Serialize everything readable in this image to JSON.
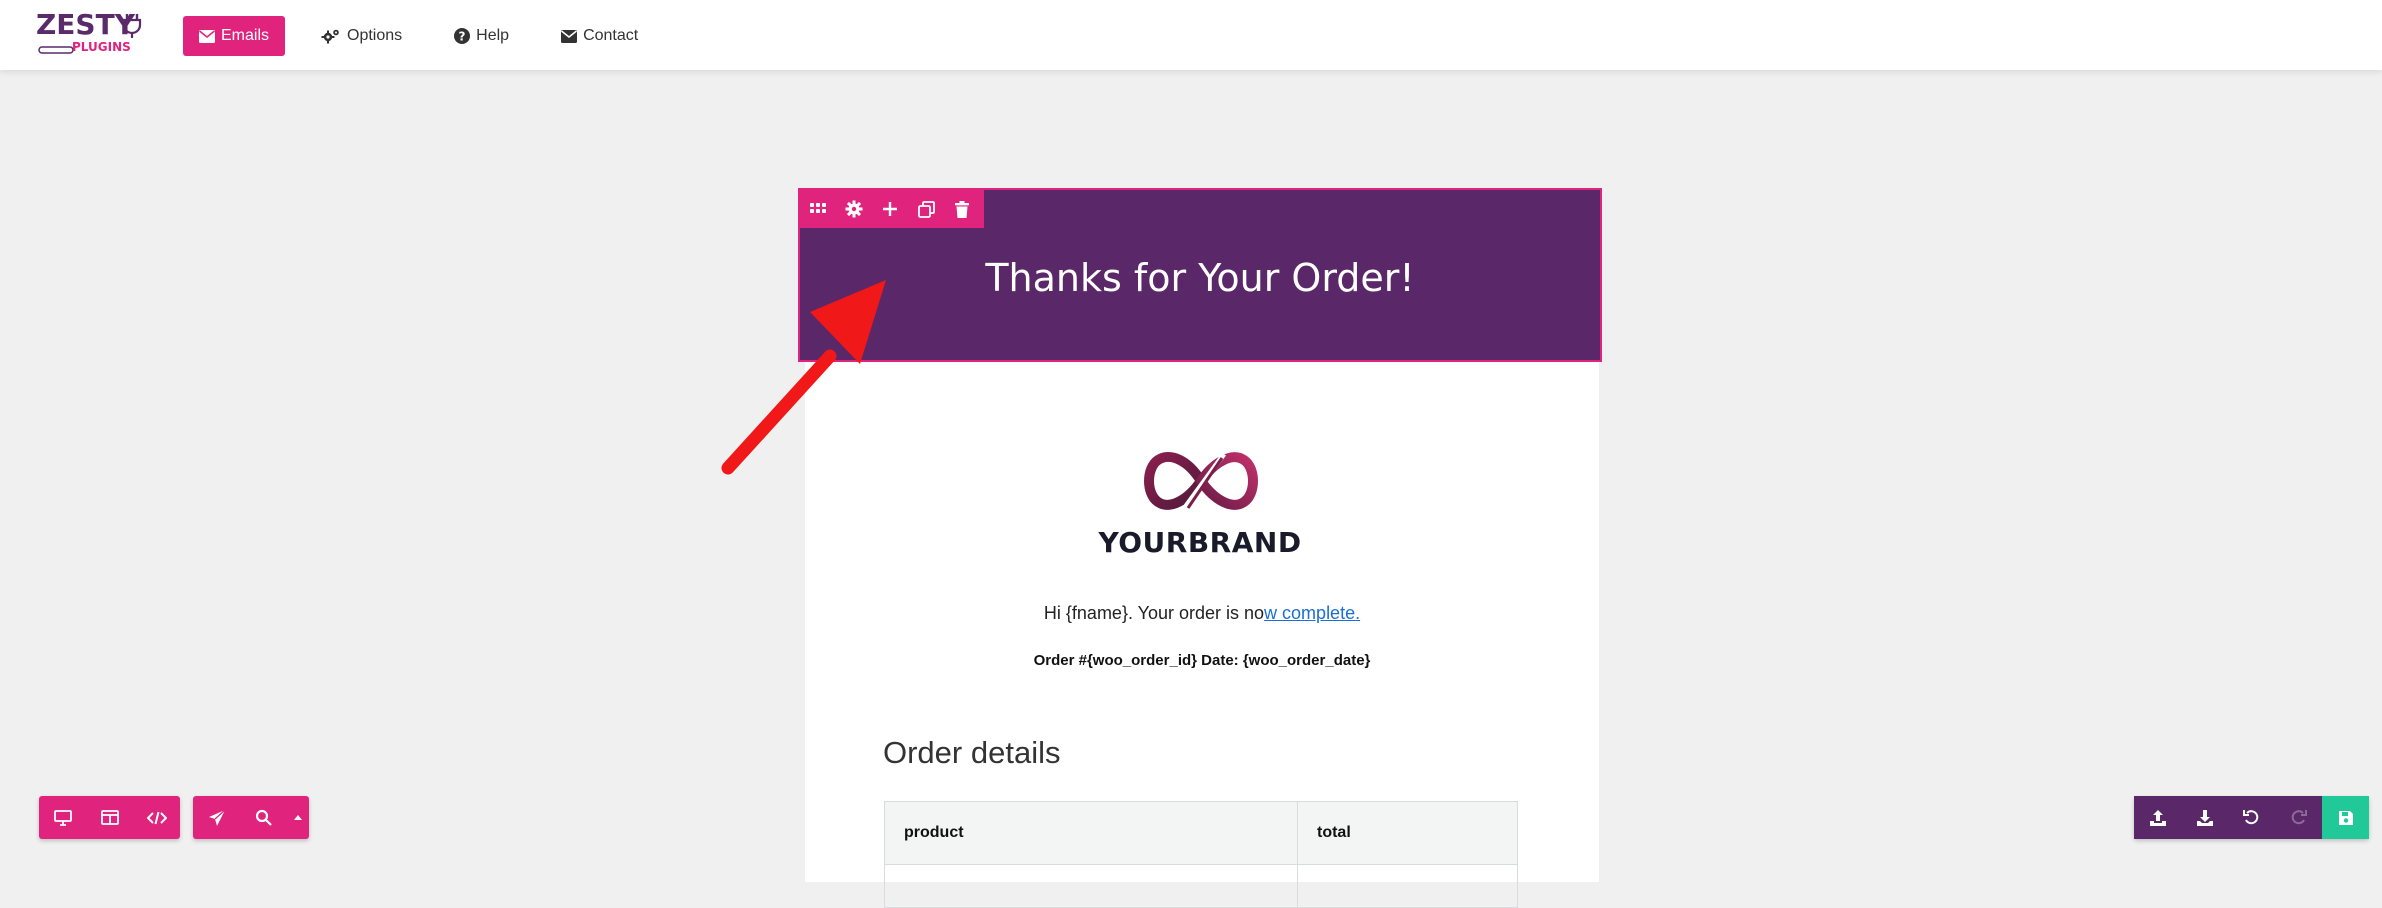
{
  "logo": {
    "top": "ZESTY",
    "bottom": "PLUGINS"
  },
  "nav": {
    "emails": "Emails",
    "options": "Options",
    "help": "Help",
    "contact": "Contact"
  },
  "email": {
    "header_title": "Thanks for Your Order!",
    "brand_name": "YOURBRAND",
    "greeting_prefix": "Hi {fname}.  Your order is no",
    "greeting_link": "w complete.",
    "order_line": "Order #{woo_order_id} Date: {woo_order_date}",
    "order_details_heading": "Order details",
    "table_headers": [
      "product",
      "total"
    ]
  },
  "colors": {
    "accent": "#e0237c",
    "header_bg": "#5a2768",
    "save": "#20c997",
    "arrow": "#f01818"
  },
  "block_toolbar_icons": [
    "grid-icon",
    "gear-icon",
    "plus-icon",
    "duplicate-icon",
    "trash-icon"
  ],
  "bottom_left_icons": [
    "desktop-icon",
    "layout-icon",
    "code-icon",
    "send-icon",
    "search-icon",
    "caret-up-icon"
  ],
  "bottom_right_icons": [
    "upload-icon",
    "download-icon",
    "undo-icon",
    "redo-icon",
    "save-icon"
  ]
}
